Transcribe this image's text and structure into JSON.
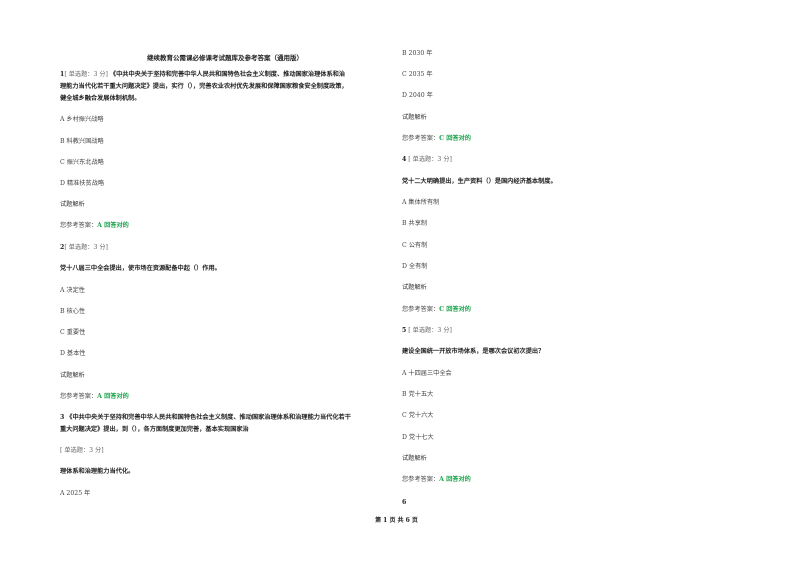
{
  "document": {
    "title": "继续教育公需课必修课考试题库及参考答案（通用版）",
    "footer": "第 1 页  共 6 页"
  },
  "left": {
    "q1": {
      "num": "1",
      "meta": "[ 单选题：3 分]",
      "stem_l1": "《中共中央关于坚持和完善中华人民共和国特色社会主义制度、推动国家治理体系和治",
      "stem_l2": "理能力当代化若干重大问题决定》提出，实行（），完善农业农村优先发展和保障国家粮食安全制度政策，",
      "stem_l3": "健全城乡融合发展体制机制。",
      "options": [
        "A 乡村振兴战略",
        "B 科教兴国战略",
        "C 振兴东北战略",
        "D 精准扶贫战略"
      ],
      "analysis": "试题解析",
      "answer_label": "您参考答案：",
      "answer_value": "A 回答对的"
    },
    "q2": {
      "num": "2",
      "meta": "[ 单选题：3 分]",
      "stem": "党十八届三中全会提出，使市场在资源配备中起（）作用。",
      "options": [
        "A 决定性",
        "B 核心性",
        "C 重要性",
        "D 基本性"
      ],
      "analysis": "试题解析",
      "answer_label": "您参考答案：",
      "answer_value": "A 回答对的"
    },
    "q3": {
      "num": "3",
      "stem_l1": "《中共中央关于坚持和完善中华人民共和国特色社会主义制度、推动国家治理体系和治理能力当代化若干",
      "stem_l2": "重大问题决定》提出，到（），各方面制度更加完善，基本实现国家治",
      "meta": "[ 单选题：3 分]",
      "stem_l3": "理体系和治理能力当代化。",
      "option_a": "A 2025 年"
    }
  },
  "right": {
    "q3_rest": {
      "options": [
        "B 2030 年",
        "C 2035 年",
        "D 2040 年"
      ],
      "analysis": "试题解析",
      "answer_label": "您参考答案：",
      "answer_value": "C 回答对的"
    },
    "q4": {
      "num": "4",
      "meta": "[ 单选题：3 分]",
      "stem": "党十二大明确提出，生产资料（）是国内经济基本制度。",
      "options": [
        "A 集体所有制",
        "B 共享制",
        "C 公有制",
        "D 全有制"
      ],
      "analysis": "试题解析",
      "answer_label": "您参考答案：",
      "answer_value": "C 回答对的"
    },
    "q5": {
      "num": "5",
      "meta": "[ 单选题：3 分]",
      "stem": "建设全国统一开放市场体系，是哪次会议初次提出？",
      "options": [
        "A 十四届三中全会",
        "B 党十五大",
        "C 党十六大",
        "D 党十七大"
      ],
      "analysis": "试题解析",
      "answer_label": "您参考答案：",
      "answer_value": "A 回答对的"
    },
    "q6": {
      "num": "6"
    }
  },
  "colors": {
    "answer_green": "#1aa34a"
  }
}
